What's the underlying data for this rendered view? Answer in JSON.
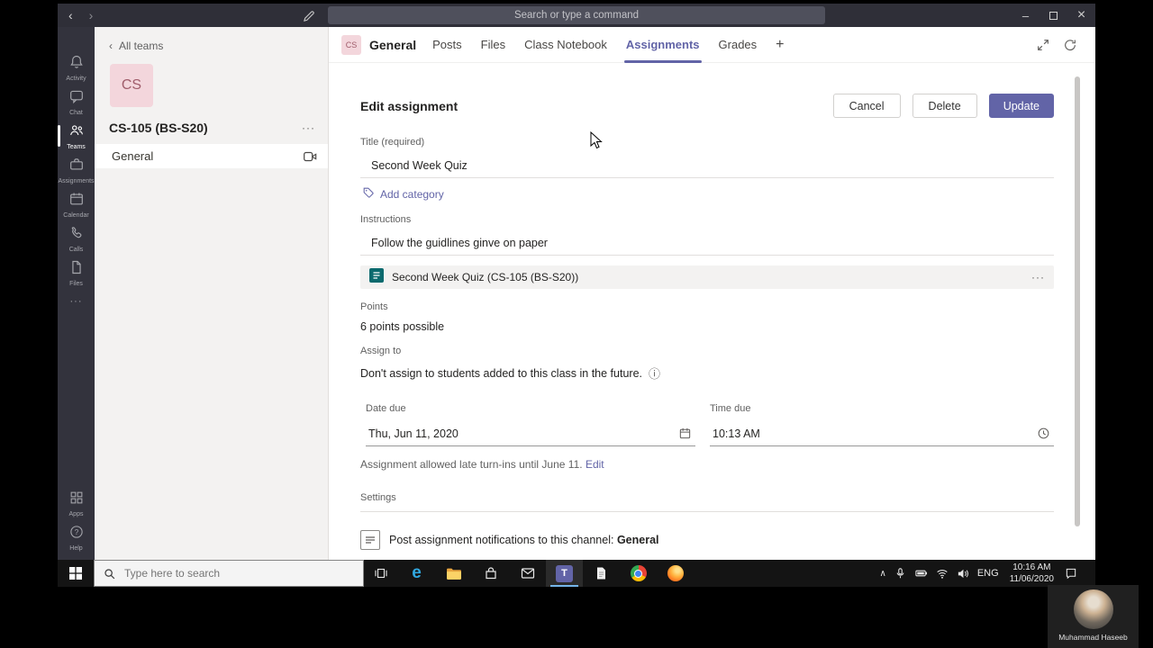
{
  "colors": {
    "accent": "#6264a7",
    "rail_bg": "#33333d",
    "sidebar_bg": "#f3f2f1",
    "forms_teal": "#0b6a6e",
    "team_avatar_bg": "#f3d6dc"
  },
  "glyphs": {
    "back": "‹",
    "forward": "›",
    "minimize": "–",
    "close": "×",
    "info": "ⓘ",
    "ellipsis": "···"
  },
  "titlebar": {
    "search_placeholder": "Search or type a command"
  },
  "rail": {
    "items": [
      {
        "label": "Activity"
      },
      {
        "label": "Chat"
      },
      {
        "label": "Teams"
      },
      {
        "label": "Assignments"
      },
      {
        "label": "Calendar"
      },
      {
        "label": "Calls"
      },
      {
        "label": "Files"
      }
    ],
    "more_glyph": "···",
    "apps_label": "Apps",
    "help_label": "Help"
  },
  "sidebar": {
    "back_glyph": "‹",
    "all_teams_label": "All teams",
    "team_initials": "CS",
    "team_name": "CS-105 (BS-S20)",
    "team_more_glyph": "···",
    "channel_name": "General"
  },
  "tabs": {
    "team_initials": "CS",
    "channel_title": "General",
    "items": [
      {
        "label": "Posts"
      },
      {
        "label": "Files"
      },
      {
        "label": "Class Notebook"
      },
      {
        "label": "Assignments"
      },
      {
        "label": "Grades"
      }
    ],
    "add_glyph": "+"
  },
  "form": {
    "heading": "Edit assignment",
    "buttons": {
      "cancel": "Cancel",
      "delete": "Delete",
      "update": "Update"
    },
    "title": {
      "label": "Title (required)",
      "value": "Second Week Quiz"
    },
    "category": {
      "add_label": "Add category"
    },
    "instructions": {
      "label": "Instructions",
      "value": "Follow the guidlines ginve on paper"
    },
    "attachment": {
      "name": "Second Week Quiz (CS-105 (BS-S20))",
      "more_glyph": "···"
    },
    "points": {
      "label": "Points",
      "value": "6 points possible"
    },
    "assign_to": {
      "label": "Assign to",
      "note": "Don't assign to students added to this class in the future.",
      "info_glyph": "ⓘ"
    },
    "date_due": {
      "label": "Date due",
      "value": "Thu, Jun 11, 2020"
    },
    "time_due": {
      "label": "Time due",
      "value": "10:13 AM"
    },
    "late_policy": {
      "text": "Assignment allowed late turn-ins until June 11.",
      "edit_label": "Edit"
    },
    "settings": {
      "label": "Settings",
      "notify_text": "Post assignment notifications to this channel:",
      "channel": "General"
    }
  },
  "taskbar": {
    "search_placeholder": "Type here to search"
  },
  "tray": {
    "hidden_icons_glyph": "∧",
    "language": "ENG",
    "time": "10:16 AM",
    "date": "11/06/2020"
  },
  "webcam": {
    "name": "Muhammad Haseeb"
  }
}
